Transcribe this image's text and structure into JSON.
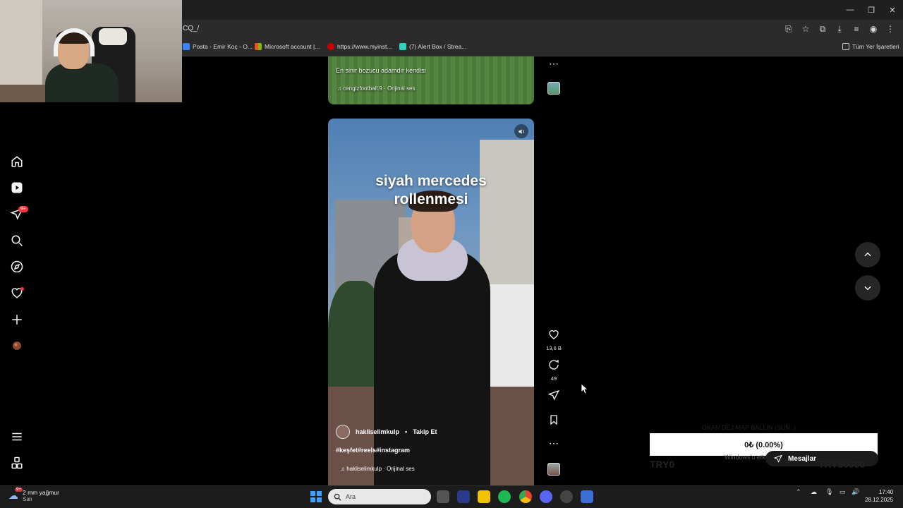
{
  "browser": {
    "url": "CQ_/",
    "bookmarks": [
      "Posta - Emir Koç - O...",
      "Microsoft account |...",
      "https://www.myinst...",
      "(7) Alert Box / Strea..."
    ],
    "all_bookmarks": "Tüm Yer İşaretleri"
  },
  "sidebar": {
    "notification_badge": "9+",
    "items": [
      "home-icon",
      "reels-icon",
      "messages-icon",
      "search-icon",
      "explore-icon",
      "notifications-icon",
      "create-icon",
      "profile-icon",
      "more-icon",
      "also-from-meta-icon"
    ]
  },
  "previous_reel": {
    "caption": "En sinir bozucu adamdır kendisi",
    "audio": "cengizfootball.9 · Orijinal ses"
  },
  "reel": {
    "overlay_title_line1": "siyah mercedes",
    "overlay_title_line2": "rollenmesi",
    "username": "hakliselimkulp",
    "separator": "•",
    "follow": "Takip Et",
    "hashtags": "#keşfet#reels#instagram",
    "audio": "hakliselimkulp · Orijinal ses"
  },
  "actions": {
    "likes": "13,6 B",
    "comments": "49"
  },
  "overlay": {
    "donation_amount": "0₺ (0.00%)",
    "goal_min": "TRY0",
    "goal_max": "TRY50000",
    "goal_title": "OKAN DEJ MAP BALLIN (SUN..)",
    "messages": "Mesajlar",
    "windows_watermark": "Windows'u etkinleştirin"
  },
  "taskbar": {
    "weather_temp": "2 mm yağmur",
    "weather_day": "Salı",
    "weather_badge": "9+",
    "search_placeholder": "Ara",
    "time": "17:40",
    "date": "28.12.2025"
  },
  "colors": {
    "accent_red": "#ff3040",
    "donation_bg": "#ffffff"
  }
}
